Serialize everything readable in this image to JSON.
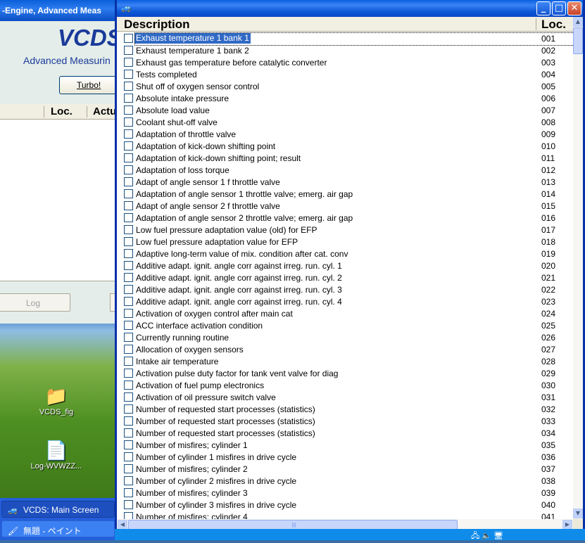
{
  "background_window": {
    "title": "-Engine,  Advanced Meas",
    "logo": "VCDS",
    "subtitle": "Advanced Measurin",
    "turbo_button": "Turbo!",
    "columns": [
      "Loc.",
      "Actu"
    ],
    "log_button": "Log"
  },
  "desktop": {
    "icons": [
      {
        "label": "VCDS_fig",
        "icon": "folder-icon"
      },
      {
        "label": "Log-WVWZZ...",
        "icon": "text-file-icon"
      }
    ]
  },
  "taskbar": {
    "items": [
      {
        "label": "VCDS:  Main Screen",
        "icon": "vcds-app-icon",
        "active": true
      },
      {
        "label": "無題 - ペイント",
        "icon": "paint-app-icon",
        "active": false
      }
    ]
  },
  "popup": {
    "title": "",
    "header": {
      "description": "Description",
      "location": "Loc."
    },
    "selected_index": 0,
    "rows": [
      {
        "description": "Exhaust temperature 1 bank 1",
        "loc": "001"
      },
      {
        "description": "Exhaust temperature 1 bank 2",
        "loc": "002"
      },
      {
        "description": "Exhaust gas temperature before catalytic converter",
        "loc": "003"
      },
      {
        "description": "Tests completed",
        "loc": "004"
      },
      {
        "description": "Shut off of oxygen sensor control",
        "loc": "005"
      },
      {
        "description": "Absolute intake pressure",
        "loc": "006"
      },
      {
        "description": "Absolute load value",
        "loc": "007"
      },
      {
        "description": "Coolant shut-off valve",
        "loc": "008"
      },
      {
        "description": "Adaptation of throttle valve",
        "loc": "009"
      },
      {
        "description": "Adaptation of kick-down shifting point",
        "loc": "010"
      },
      {
        "description": "Adaptation of kick-down shifting point; result",
        "loc": "011"
      },
      {
        "description": "Adaptation of loss torque",
        "loc": "012"
      },
      {
        "description": "Adapt of angle sensor 1 f throttle valve",
        "loc": "013"
      },
      {
        "description": "Adaptation of angle sensor 1 throttle valve; emerg. air gap",
        "loc": "014"
      },
      {
        "description": "Adapt of angle sensor 2 f throttle valve",
        "loc": "015"
      },
      {
        "description": "Adaptation of angle sensor 2 throttle valve; emerg. air gap",
        "loc": "016"
      },
      {
        "description": "Low fuel pressure adaptation value (old) for EFP",
        "loc": "017"
      },
      {
        "description": "Low fuel pressure adaptation value for EFP",
        "loc": "018"
      },
      {
        "description": "Adaptive long-term value of mix. condition after cat. conv",
        "loc": "019"
      },
      {
        "description": "Additive adapt. ignit. angle corr against irreg. run. cyl. 1",
        "loc": "020"
      },
      {
        "description": "Additive adapt. ignit. angle corr against irreg. run. cyl. 2",
        "loc": "021"
      },
      {
        "description": "Additive adapt. ignit. angle corr against irreg. run. cyl. 3",
        "loc": "022"
      },
      {
        "description": "Additive adapt. ignit. angle corr against irreg. run. cyl. 4",
        "loc": "023"
      },
      {
        "description": "Activation of oxygen control after main cat",
        "loc": "024"
      },
      {
        "description": "ACC interface activation condition",
        "loc": "025"
      },
      {
        "description": "Currently running routine",
        "loc": "026"
      },
      {
        "description": "Allocation of oxygen sensors",
        "loc": "027"
      },
      {
        "description": "Intake air temperature",
        "loc": "028"
      },
      {
        "description": "Activation pulse duty factor for tank vent valve for diag",
        "loc": "029"
      },
      {
        "description": "Activation of fuel pump electronics",
        "loc": "030"
      },
      {
        "description": "Activation of oil pressure switch valve",
        "loc": "031"
      },
      {
        "description": "Number of requested start processes (statistics)",
        "loc": "032"
      },
      {
        "description": "Number of requested start processes (statistics)",
        "loc": "033"
      },
      {
        "description": "Number of requested start processes (statistics)",
        "loc": "034"
      },
      {
        "description": "Number of misfires; cylinder 1",
        "loc": "035"
      },
      {
        "description": "Number of cylinder 1 misfires in drive cycle",
        "loc": "036"
      },
      {
        "description": "Number of misfires; cylinder 2",
        "loc": "037"
      },
      {
        "description": "Number of cylinder 2 misfires in drive cycle",
        "loc": "038"
      },
      {
        "description": "Number of misfires; cylinder 3",
        "loc": "039"
      },
      {
        "description": "Number of cylinder 3 misfires in drive cycle",
        "loc": "040"
      },
      {
        "description": "Number of misfires; cylinder 4",
        "loc": "041"
      }
    ]
  },
  "colors": {
    "selection": "#316ac5",
    "titlebar": "#0a5fe0",
    "checkbox_border": "#1c5180"
  }
}
